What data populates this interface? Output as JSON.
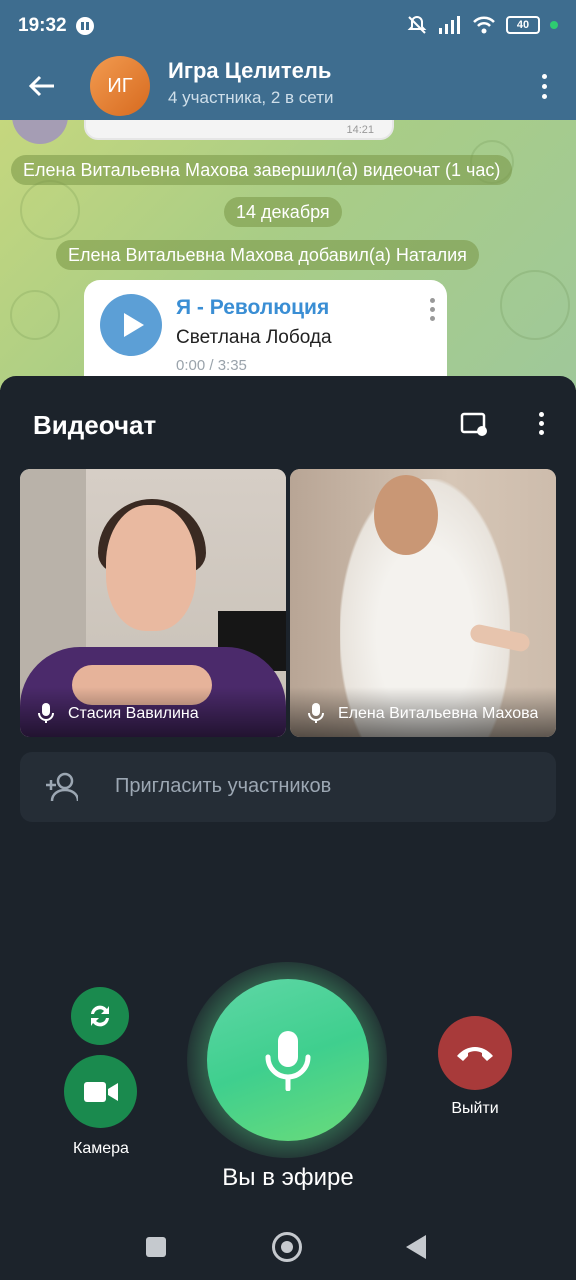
{
  "status_bar": {
    "time": "19:32",
    "battery": "40"
  },
  "chat_header": {
    "avatar_initials": "ИГ",
    "title": "Игра Целитель",
    "subtitle": "4 участника, 2 в сети"
  },
  "chat": {
    "previous_time": "14:21",
    "service_messages": [
      "Елена Витальевна Махова завершил(а) видеочат (1 час)",
      "14 декабря",
      "Елена Витальевна Махова добавил(а) Наталия"
    ],
    "audio": {
      "title": "Я - Революция",
      "artist": "Светлана Лобода",
      "duration": "0:00 / 3:35"
    }
  },
  "video_chat": {
    "title": "Видеочат",
    "participants": [
      {
        "name": "Стасия Вавилина"
      },
      {
        "name": "Елена Витальевна Махова"
      }
    ],
    "invite_label": "Пригласить участников",
    "camera_label": "Камера",
    "leave_label": "Выйти",
    "mic_status": "Вы в эфире"
  },
  "colors": {
    "header_bg": "#3e6d8f",
    "panel_bg": "#1c232b",
    "mic_green": "#3fcf8e",
    "camera_green": "#1a8a4e",
    "leave_red": "#a83a3a",
    "accent_blue": "#3a8ed4"
  },
  "icons": [
    "back-arrow-icon",
    "more-vertical-icon",
    "play-icon",
    "screen-cast-icon",
    "microphone-icon",
    "add-person-icon",
    "flip-camera-icon",
    "video-camera-icon",
    "hang-up-icon"
  ]
}
